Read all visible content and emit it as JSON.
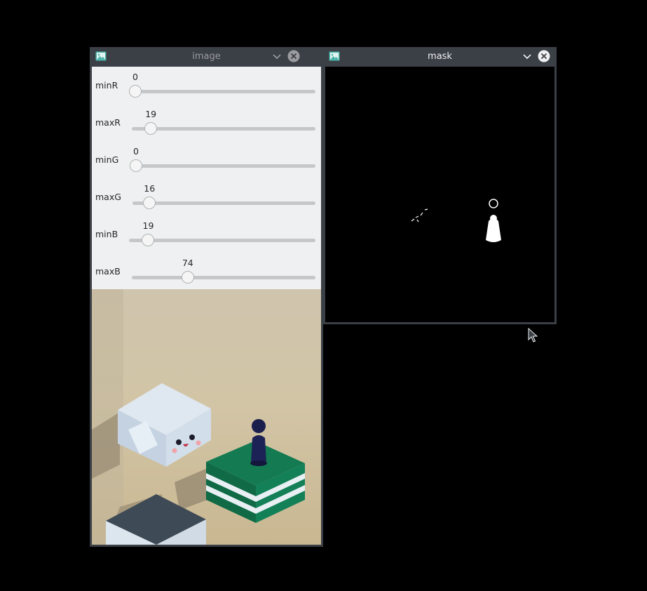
{
  "windows": {
    "image": {
      "title": "image",
      "trackbars": [
        {
          "label": "minR",
          "value": 0,
          "max": 255
        },
        {
          "label": "maxR",
          "value": 19,
          "max": 255
        },
        {
          "label": "minG",
          "value": 0,
          "max": 255
        },
        {
          "label": "maxG",
          "value": 16,
          "max": 255
        },
        {
          "label": "minB",
          "value": 19,
          "max": 255
        },
        {
          "label": "maxB",
          "value": 74,
          "max": 255
        }
      ]
    },
    "mask": {
      "title": "mask"
    }
  },
  "colors": {
    "titlebar": "#3b3f46",
    "title_inactive": "#9a9ca0",
    "title_active": "#eff0f1",
    "panel_bg": "#eff0f1",
    "close_active": "#eff0f1",
    "app_icon": "#4db6ac"
  },
  "icons": {
    "window_icon": "image-icon",
    "minimize": "chevron-down-icon",
    "close": "close-circle-icon",
    "pointer": "mouse-pointer-icon"
  }
}
